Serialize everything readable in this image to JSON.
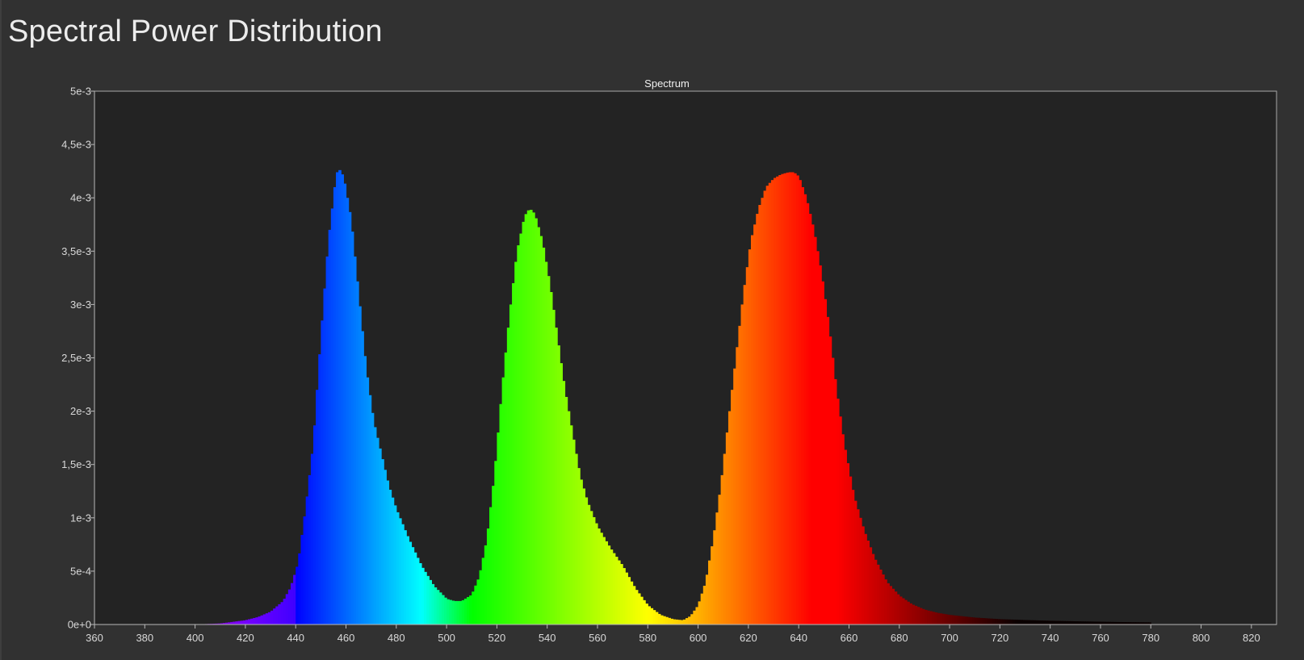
{
  "page": {
    "title": "Spectral Power Distribution"
  },
  "chart_data": {
    "type": "area",
    "title": "Spectrum",
    "xlabel": "",
    "ylabel": "",
    "xlim": [
      360,
      830
    ],
    "ylim": [
      0,
      0.005
    ],
    "x_ticks": [
      360,
      380,
      400,
      420,
      440,
      460,
      480,
      500,
      520,
      540,
      560,
      580,
      600,
      620,
      640,
      660,
      680,
      700,
      720,
      740,
      760,
      780,
      800,
      820
    ],
    "x_tick_labels": [
      "360",
      "380",
      "400",
      "420",
      "440",
      "460",
      "480",
      "500",
      "520",
      "540",
      "560",
      "580",
      "600",
      "620",
      "640",
      "660",
      "680",
      "700",
      "720",
      "740",
      "760",
      "780",
      "800",
      "820"
    ],
    "y_ticks": [
      0,
      0.0005,
      0.001,
      0.0015,
      0.002,
      0.0025,
      0.003,
      0.0035,
      0.004,
      0.0045,
      0.005
    ],
    "y_tick_labels": [
      "0e+0",
      "5e-4",
      "1e-3",
      "1,5e-3",
      "2e-3",
      "2,5e-3",
      "3e-3",
      "3,5e-3",
      "4e-3",
      "4,5e-3",
      "5e-3"
    ],
    "grid": false,
    "fill": "wavelength-colored spectrum",
    "background_color": "#232323",
    "axis_color": "#a8a8a8",
    "x": [
      400,
      410,
      420,
      425,
      430,
      435,
      438,
      441,
      444,
      447,
      450,
      453,
      456,
      457,
      459,
      462,
      465,
      468,
      471,
      474,
      477,
      480,
      485,
      490,
      495,
      500,
      503,
      506,
      510,
      513,
      516,
      519,
      522,
      525,
      528,
      531,
      533,
      535,
      538,
      541,
      544,
      547,
      550,
      553,
      556,
      560,
      565,
      570,
      575,
      580,
      585,
      590,
      594,
      597,
      600,
      603,
      606,
      609,
      612,
      615,
      618,
      621,
      624,
      627,
      630,
      633,
      636,
      638,
      640,
      643,
      646,
      649,
      652,
      655,
      658,
      662,
      666,
      670,
      675,
      680,
      685,
      690,
      695,
      700,
      710,
      720,
      730,
      740,
      750,
      760,
      770,
      780
    ],
    "y": [
      0.0,
      1e-05,
      4e-05,
      7e-05,
      0.00012,
      0.00022,
      0.00035,
      0.00058,
      0.0011,
      0.0017,
      0.0027,
      0.0036,
      0.0042,
      0.00428,
      0.0042,
      0.0038,
      0.0031,
      0.0024,
      0.0019,
      0.0016,
      0.0013,
      0.00108,
      0.0008,
      0.00055,
      0.00036,
      0.00024,
      0.00022,
      0.00022,
      0.00028,
      0.00045,
      0.0008,
      0.0014,
      0.0022,
      0.0029,
      0.0035,
      0.00383,
      0.0039,
      0.00385,
      0.0036,
      0.0032,
      0.0027,
      0.0022,
      0.0018,
      0.0014,
      0.00115,
      0.00092,
      0.00072,
      0.00055,
      0.00034,
      0.00018,
      9e-05,
      5e-05,
      4e-05,
      8e-05,
      0.00018,
      0.0004,
      0.0008,
      0.0013,
      0.0019,
      0.0025,
      0.0031,
      0.0036,
      0.0039,
      0.0041,
      0.00418,
      0.00422,
      0.00424,
      0.00424,
      0.0042,
      0.004,
      0.0037,
      0.0033,
      0.0028,
      0.0022,
      0.0017,
      0.0012,
      0.00088,
      0.00063,
      0.0004,
      0.00027,
      0.00019,
      0.00014,
      0.00011,
      9e-05,
      6.5e-05,
      5e-05,
      4.2e-05,
      3.5e-05,
      3e-05,
      2.6e-05,
      2.2e-05,
      2e-05
    ]
  }
}
